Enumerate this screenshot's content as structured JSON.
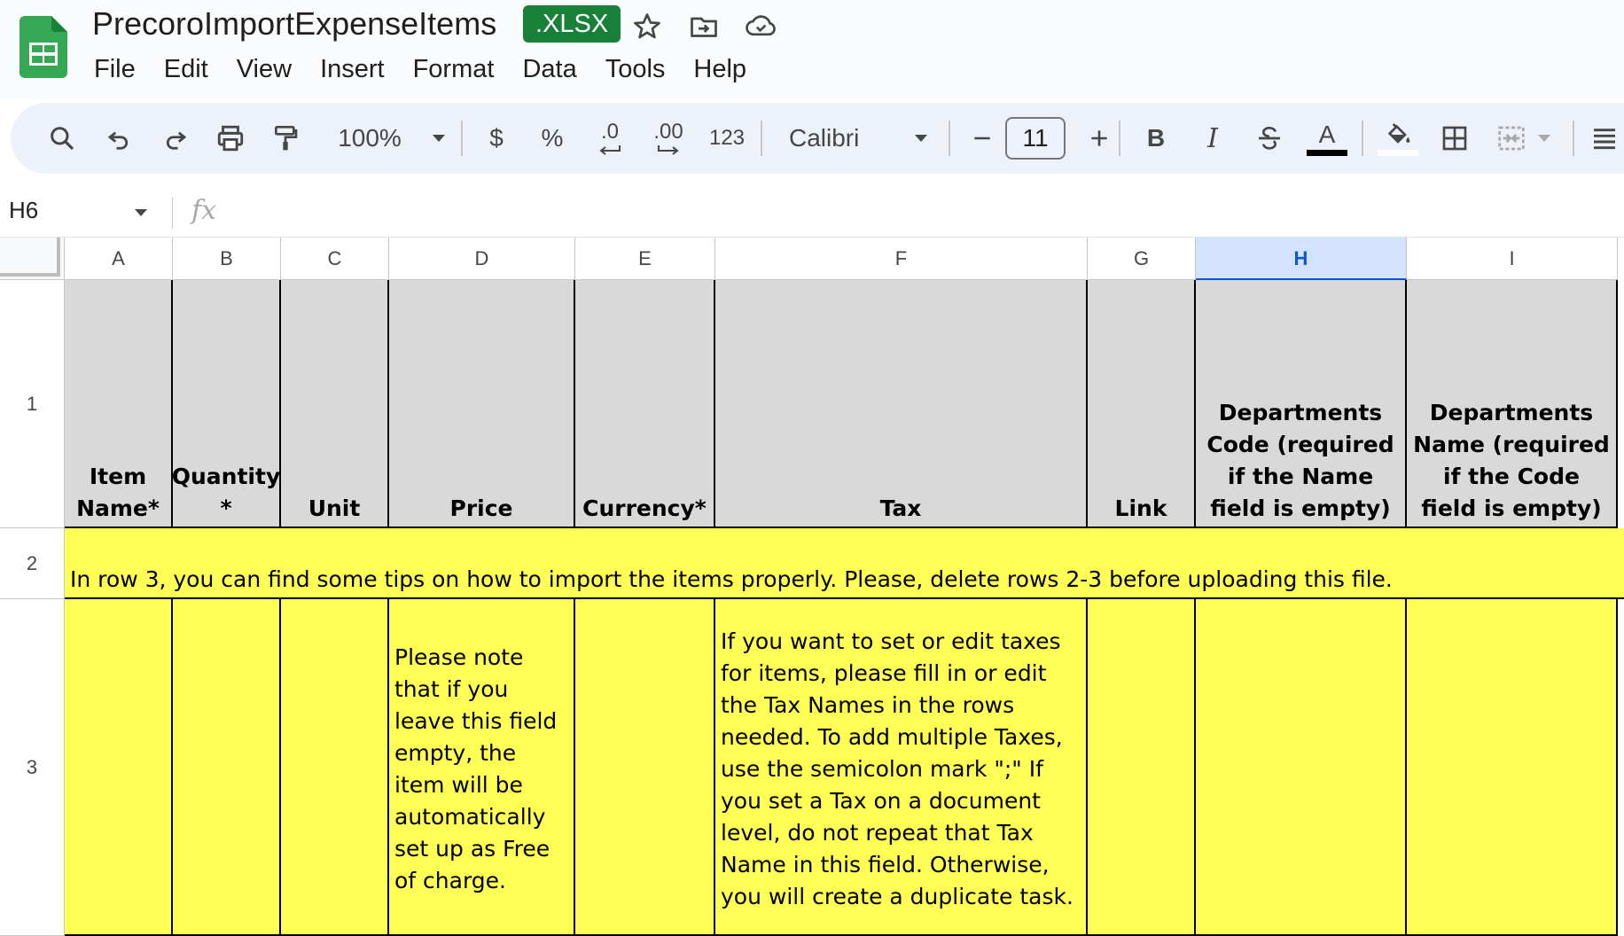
{
  "document": {
    "title": "PrecoroImportExpenseItems",
    "format_badge": ".XLSX"
  },
  "menu": [
    "File",
    "Edit",
    "View",
    "Insert",
    "Format",
    "Data",
    "Tools",
    "Help"
  ],
  "toolbar": {
    "zoom": "100%",
    "currency_label": "$",
    "percent_label": "%",
    "decrease_decimal_label": ".0",
    "increase_decimal_label": ".00",
    "more_formats_label": "123",
    "font": "Calibri",
    "font_size": "11",
    "bold_label": "B",
    "italic_label": "I",
    "text_color_label": "A"
  },
  "formula_bar": {
    "cell_ref": "H6",
    "fx_label": "fx",
    "value": ""
  },
  "columns": [
    "A",
    "B",
    "C",
    "D",
    "E",
    "F",
    "G",
    "H",
    "I"
  ],
  "selected_column": "H",
  "rows": [
    "1",
    "2",
    "3"
  ],
  "header_row": {
    "a": "Item Name*",
    "b": "Quantity *",
    "c": "Unit",
    "d": "Price",
    "e": "Currency*",
    "f": "Tax",
    "g": "Link",
    "h": "Departments Code (required if the Name field is empty)",
    "i": "Departments Name (required if the Code field is empty)"
  },
  "row2_text": "In row 3, you can find some tips on how to import the items properly. Please, delete rows 2-3 before uploading this file.",
  "row3": {
    "d": "Please note that if you leave this field empty, the item will be automatically set up as Free of charge.",
    "f": "If you want to set or edit taxes for items, please fill in or edit the Tax Names in the rows needed. To add multiple Taxes, use the semicolon mark \";\" If you set a Tax on a document level, do not repeat that Tax Name in this field. Otherwise, you will create a duplicate task."
  },
  "colors": {
    "header_fill": "#d9d9d9",
    "note_fill": "#ffff55",
    "badge": "#188038",
    "selected_column": "#d3e3fd"
  }
}
